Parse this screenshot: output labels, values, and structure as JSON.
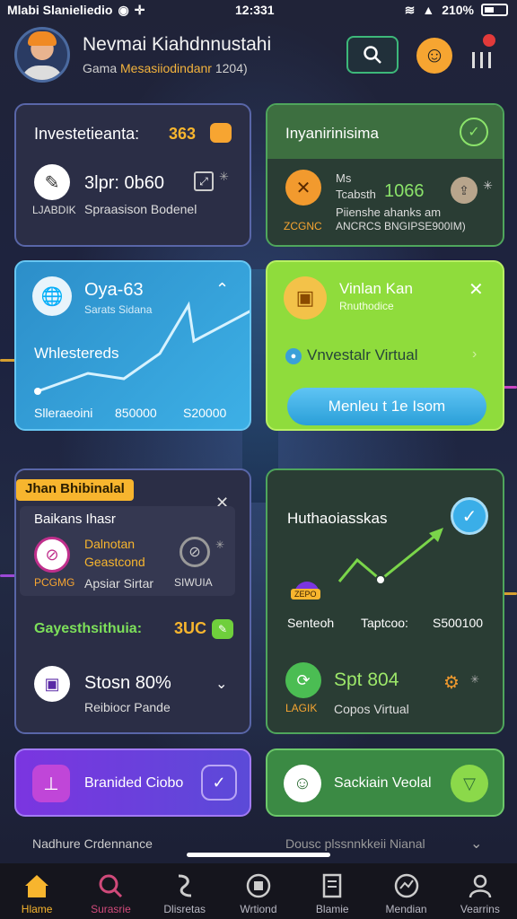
{
  "status_bar": {
    "carrier": "Mlabi Slanieliedio",
    "time": "12:331",
    "battery": "210%"
  },
  "header": {
    "user_name": "Nevmai Kiahdnnustahi",
    "subtitle_plain": "Gama",
    "subtitle_accent": "Mesasiiodindanr",
    "subtitle_rest": "1204)"
  },
  "cards": {
    "investments": {
      "title": "Investetieanta:",
      "badge": "363",
      "metric": "3lpr: 0b60",
      "sub_left": "LJABDIK",
      "sub_right": "Spraasison Bodenel"
    },
    "inventory": {
      "title": "Inyanirinisima",
      "line1": "Ms",
      "line2_label": "Tcabsth",
      "line2_value": "1066",
      "sub_label": "ZCGNC",
      "sub_line1": "Piienshe ahanks am",
      "sub_line2": "ANCRCS BNGIPSE900IM)"
    },
    "chart_card": {
      "title": "Oya-63",
      "subtitle": "Sarats Sidana",
      "label": "Whlestereds",
      "axis_left": "Slleraeoini",
      "axis_mid": "850000",
      "axis_right": "S20000"
    },
    "virtual": {
      "title": "Vinlan Kan",
      "subtitle": "Rnuthodice",
      "row_text": "Vnvestalr Virtual",
      "button": "Menleu t 1e Isom"
    },
    "badge_card": {
      "tag": "Jhan Bhibinalal",
      "title": "Baikans Ihasr",
      "item1": "Dalnotan",
      "item2": "Geastcond",
      "left_sub": "PCGMG",
      "mid_sub": "Apsiar Sirtar",
      "right_sub": "SIWUIA",
      "green_label": "Gayesthsithuia:",
      "green_value": "3UC",
      "stat_value": "Stosn 80%",
      "stat_sub": "Reibiocr Pande"
    },
    "progress_card": {
      "title": "Huthaoiasskas",
      "tag": "ZEPO",
      "axis_left": "Senteoh",
      "axis_mid": "Taptcoo:",
      "axis_right": "S500100",
      "spt": "Spt 804",
      "spt_sub_left": "LAGIK",
      "spt_sub_right": "Copos Virtual"
    },
    "purple_card": {
      "label": "Branided Ciobo"
    },
    "green_card": {
      "label": "Sackiain Veolal"
    }
  },
  "peek": {
    "left": "Nadhure Crdennance",
    "right": "Dousc plssnnkkeii Nianal"
  },
  "nav": [
    {
      "label": "Hlame",
      "icon": "home-icon"
    },
    {
      "label": "Surasrie",
      "icon": "search-icon"
    },
    {
      "label": "Dlisretas",
      "icon": "stats-icon"
    },
    {
      "label": "Wrtiond",
      "icon": "wallet-icon"
    },
    {
      "label": "Blamie",
      "icon": "document-icon"
    },
    {
      "label": "Mendian",
      "icon": "chart-icon"
    },
    {
      "label": "Vearrins",
      "icon": "profile-icon"
    }
  ],
  "colors": {
    "accent_orange": "#f7b52e",
    "accent_green": "#4fa65c",
    "lime": "#8fdc3c",
    "blue": "#2c8ec9",
    "purple": "#7b35e0"
  }
}
